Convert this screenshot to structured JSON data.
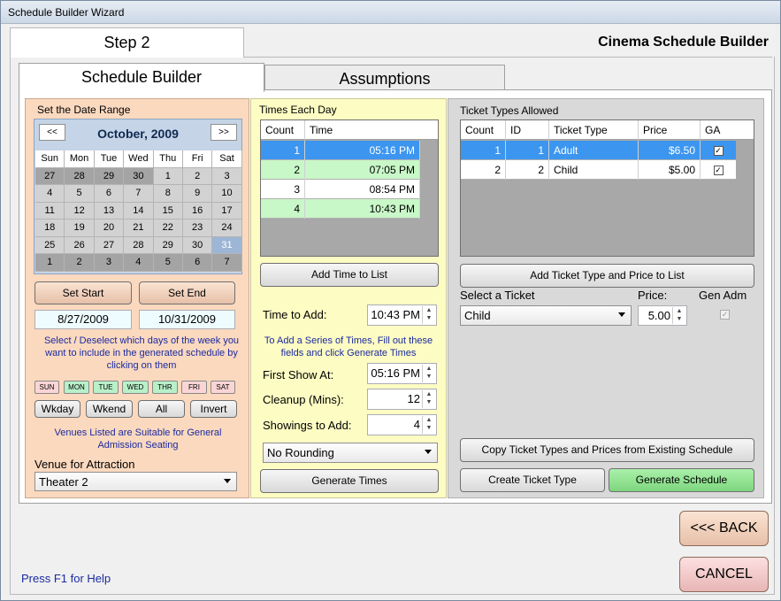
{
  "window": {
    "title": "Schedule Builder Wizard"
  },
  "step_tab": "Step 2",
  "app_title": "Cinema Schedule Builder",
  "tabs": [
    {
      "label": "Schedule Builder"
    },
    {
      "label": "Assumptions"
    }
  ],
  "left": {
    "title": "Set the Date Range",
    "calendar": {
      "prev": "<<",
      "next": ">>",
      "month": "October, 2009",
      "days": [
        "Sun",
        "Mon",
        "Tue",
        "Wed",
        "Thu",
        "Fri",
        "Sat"
      ],
      "weeks": [
        [
          "27",
          "28",
          "29",
          "30",
          "1",
          "2",
          "3"
        ],
        [
          "4",
          "5",
          "6",
          "7",
          "8",
          "9",
          "10"
        ],
        [
          "11",
          "12",
          "13",
          "14",
          "15",
          "16",
          "17"
        ],
        [
          "18",
          "19",
          "20",
          "21",
          "22",
          "23",
          "24"
        ],
        [
          "25",
          "26",
          "27",
          "28",
          "29",
          "30",
          "31"
        ],
        [
          "1",
          "2",
          "3",
          "4",
          "5",
          "6",
          "7"
        ]
      ]
    },
    "set_start": "Set Start",
    "set_end": "Set End",
    "start_date": "8/27/2009",
    "end_date": "10/31/2009",
    "instructions": "Select / Deselect which days of the week you want to include in the generated schedule by clicking on them",
    "day_buttons": [
      "SUN",
      "MON",
      "TUE",
      "WED",
      "THR",
      "FRI",
      "SAT"
    ],
    "wkday": "Wkday",
    "wkend": "Wkend",
    "all": "All",
    "invert": "Invert",
    "venues_note": "Venues Listed are Suitable for General Admission Seating",
    "venue_label": "Venue for Attraction",
    "venue_value": "Theater 2"
  },
  "mid": {
    "title": "Times Each Day",
    "headers": [
      "Count",
      "Time"
    ],
    "rows": [
      {
        "count": "1",
        "time": "05:16 PM"
      },
      {
        "count": "2",
        "time": "07:05 PM"
      },
      {
        "count": "3",
        "time": "08:54 PM"
      },
      {
        "count": "4",
        "time": "10:43 PM"
      }
    ],
    "add_time_btn": "Add Time to List",
    "time_to_add_label": "Time to Add:",
    "time_to_add": "10:43 PM",
    "series_note": "To Add a Series of Times, Fill out these fields and click Generate Times",
    "first_show_label": "First Show At:",
    "first_show": "05:16 PM",
    "cleanup_label": "Cleanup (Mins):",
    "cleanup": "12",
    "showings_label": "Showings to Add:",
    "showings": "4",
    "rounding": "No Rounding",
    "generate_times_btn": "Generate Times"
  },
  "right": {
    "title": "Ticket Types Allowed",
    "headers": [
      "Count",
      "ID",
      "Ticket Type",
      "Price",
      "GA"
    ],
    "rows": [
      {
        "count": "1",
        "id": "1",
        "type": "Adult",
        "price": "$6.50",
        "ga": "✓"
      },
      {
        "count": "2",
        "id": "2",
        "type": "Child",
        "price": "$5.00",
        "ga": "✓"
      }
    ],
    "add_ticket_btn": "Add Ticket Type and Price to List",
    "select_label": "Select a Ticket",
    "price_label": "Price:",
    "gen_adm_label": "Gen Adm",
    "ticket_value": "Child",
    "price_value": "5.00",
    "gen_adm_check": "✓",
    "copy_btn": "Copy Ticket Types and Prices from Existing Schedule",
    "create_btn": "Create Ticket Type",
    "generate_btn": "Generate Schedule"
  },
  "back_btn": "<<< BACK",
  "cancel_btn": "CANCEL",
  "help": "Press F1 for Help"
}
